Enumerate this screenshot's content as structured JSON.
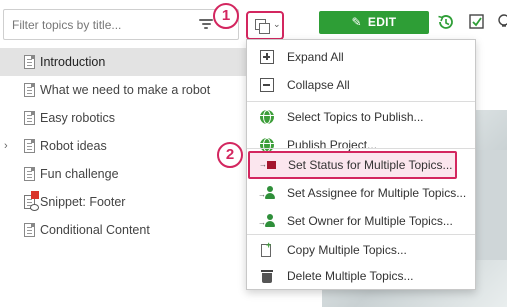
{
  "filter": {
    "placeholder": "Filter topics by title..."
  },
  "topics": [
    {
      "label": "Introduction",
      "selected": true
    },
    {
      "label": "What we need to make a robot"
    },
    {
      "label": "Easy robotics"
    },
    {
      "label": "Robot ideas",
      "expandable": true
    },
    {
      "label": "Fun challenge"
    },
    {
      "label": "Snippet: Footer",
      "snippet": true
    },
    {
      "label": "Conditional Content"
    }
  ],
  "expander_glyph": "›",
  "toolbar": {
    "edit_label": "EDIT",
    "edit_color": "#2e9e36",
    "multi_button_chevron": "⌄"
  },
  "markers": {
    "one": "1",
    "two": "2",
    "color": "#d3265f"
  },
  "menu": {
    "items": [
      {
        "label": "Expand All",
        "icon": "plus-box-icon"
      },
      {
        "label": "Collapse All",
        "icon": "minus-box-icon"
      },
      {
        "label": "Select Topics to Publish...",
        "icon": "globe-icon"
      },
      {
        "label": "Publish Project...",
        "icon": "globe-icon"
      },
      {
        "label": "Set Status for Multiple Topics...",
        "icon": "status-icon",
        "highlighted": true
      },
      {
        "label": "Set Assignee for Multiple Topics...",
        "icon": "assignee-icon"
      },
      {
        "label": "Set Owner for Multiple Topics...",
        "icon": "owner-icon"
      },
      {
        "label": "Copy Multiple Topics...",
        "icon": "copy-icon"
      },
      {
        "label": "Delete Multiple Topics...",
        "icon": "trash-icon"
      }
    ]
  }
}
